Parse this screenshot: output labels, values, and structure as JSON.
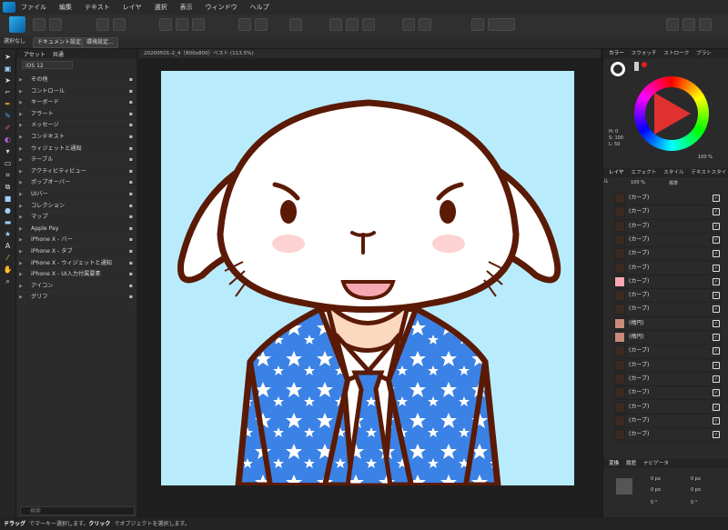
{
  "menu": [
    "ファイル",
    "編集",
    "テキスト",
    "レイヤ",
    "選択",
    "表示",
    "ウィンドウ",
    "ヘルプ"
  ],
  "context": {
    "selection": "選択なし",
    "doc_setup": "ドキュメント設定...",
    "env_setup": "環境設定..."
  },
  "assets": {
    "tabs": [
      "アセット",
      "共通"
    ],
    "dropdown": "iOS 12",
    "items": [
      "その他",
      "コントロール",
      "キーボード",
      "アラート",
      "メッセージ",
      "コンテキスト",
      "ウィジェットと通知",
      "テーブル",
      "アクティビティビュー",
      "ポップオーバー",
      "UIバー",
      "コレクション",
      "マップ",
      "Apple Pay",
      "iPhone X - バー",
      "iPhone X - タブ",
      "iPhone X - ウィジェットと通知",
      "iPhone X - UI入力付属要素",
      "アイコン",
      "グリフ"
    ],
    "search_placeholder": "検索"
  },
  "document": {
    "title": "20200501-2_4（800x800）ベスト (113.5%)"
  },
  "color_panel": {
    "tabs": [
      "カラー",
      "スウォッチ",
      "ストローク",
      "ブラシ"
    ],
    "h": "H: 0",
    "s": "S: 100",
    "l": "L: 50",
    "opacity": "100 %"
  },
  "layers_panel": {
    "tabs": [
      "レイヤ",
      "エフェクト",
      "スタイル",
      "テキストスタイル"
    ],
    "opacity": "100 %",
    "blend": "標準",
    "layers": [
      "(カーブ)",
      "(カーブ)",
      "(カーブ)",
      "(カーブ)",
      "(カーブ)",
      "(カーブ)",
      "(カーブ)",
      "(カーブ)",
      "(カーブ)",
      "(楕円)",
      "(楕円)",
      "(カーブ)",
      "(カーブ)",
      "(カーブ)",
      "(カーブ)",
      "(カーブ)",
      "(カーブ)",
      "(カーブ)"
    ]
  },
  "transform_panel": {
    "tabs": [
      "変換",
      "履歴",
      "ナビゲータ"
    ],
    "fields": [
      "0 px",
      "0 px",
      "0 px",
      "0 px"
    ],
    "angles": [
      "0 °",
      "0 °"
    ]
  },
  "status": {
    "drag": "ドラッグ",
    "text1": "でマーキー選択します。",
    "click": "クリック",
    "text2": "でオブジェクトを選択します。"
  },
  "colors": {
    "background": "#b8ecfd",
    "rabbit": "#ffffff",
    "outline": "#5a1a05",
    "suit": "#3b82e6",
    "cheek": "#fcd2d2"
  }
}
